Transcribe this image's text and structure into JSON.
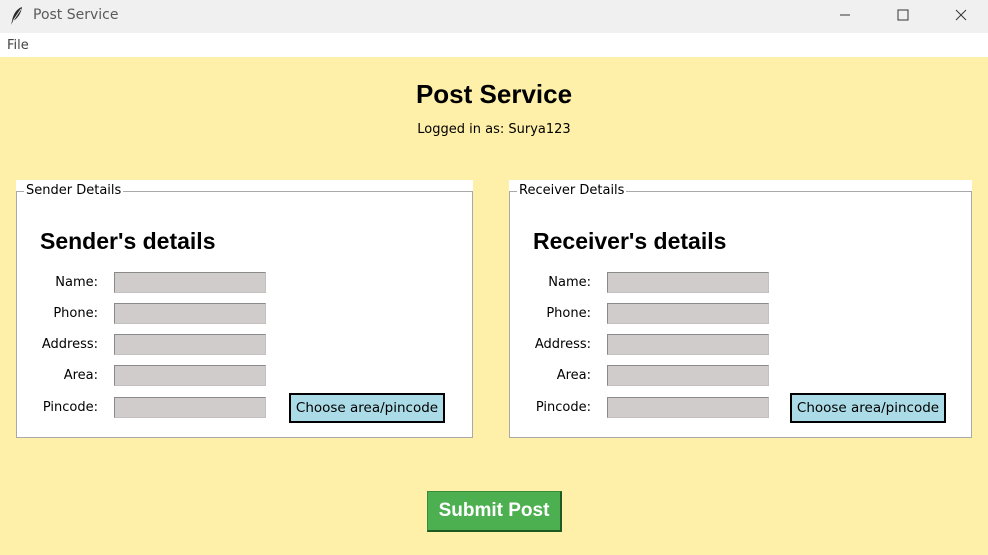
{
  "window": {
    "title": "Post Service"
  },
  "menu": {
    "file": "File"
  },
  "header": {
    "title": "Post Service",
    "logged_in": "Logged in as: Surya123"
  },
  "sender": {
    "frame_label": "Sender Details",
    "title": "Sender's details",
    "labels": {
      "name": "Name:",
      "phone": "Phone:",
      "address": "Address:",
      "area": "Area:",
      "pincode": "Pincode:"
    },
    "values": {
      "name": "",
      "phone": "",
      "address": "",
      "area": "",
      "pincode": ""
    },
    "choose_button": "Choose area/pincode"
  },
  "receiver": {
    "frame_label": "Receiver Details",
    "title": "Receiver's details",
    "labels": {
      "name": "Name:",
      "phone": "Phone:",
      "address": "Address:",
      "area": "Area:",
      "pincode": "Pincode:"
    },
    "values": {
      "name": "",
      "phone": "",
      "address": "",
      "area": "",
      "pincode": ""
    },
    "choose_button": "Choose area/pincode"
  },
  "submit_label": "Submit Post",
  "colors": {
    "background": "#fef0a8",
    "submit": "#4caf50",
    "choose": "#aadbe6",
    "entry": "#d0cccc"
  },
  "icons": {
    "app": "feather-icon",
    "minimize": "minimize-icon",
    "maximize": "maximize-icon",
    "close": "close-icon"
  }
}
